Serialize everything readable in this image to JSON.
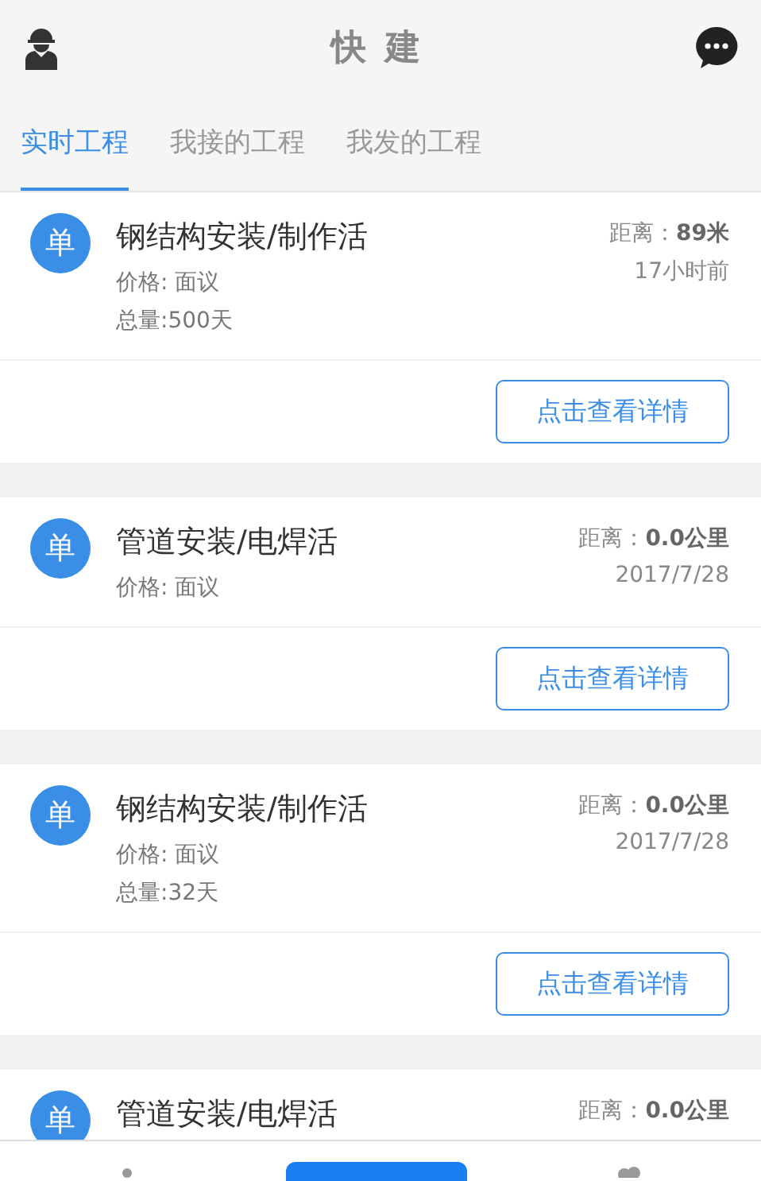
{
  "header": {
    "title": "快 建"
  },
  "tabs": [
    {
      "label": "实时工程",
      "selected": true
    },
    {
      "label": "我接的工程",
      "selected": false
    },
    {
      "label": "我发的工程",
      "selected": false
    }
  ],
  "cards": [
    {
      "badge": "单",
      "title": "钢结构安装/制作活",
      "info": [
        "价格: 面议",
        "总量:500天"
      ],
      "distance_label": "距离：",
      "distance": "89米",
      "time": "17小时前",
      "button": "点击查看详情"
    },
    {
      "badge": "单",
      "title": "管道安装/电焊活",
      "info": [
        "价格: 面议"
      ],
      "distance_label": "距离：",
      "distance": "0.0公里",
      "time": "2017/7/28",
      "button": "点击查看详情"
    },
    {
      "badge": "单",
      "title": "钢结构安装/制作活",
      "info": [
        "价格: 面议",
        "总量:32天"
      ],
      "distance_label": "距离：",
      "distance": "0.0公里",
      "time": "2017/7/28",
      "button": "点击查看详情"
    },
    {
      "badge": "单",
      "title": "管道安装/电焊活",
      "distance_label": "距离：",
      "distance": "0.0公里"
    }
  ]
}
